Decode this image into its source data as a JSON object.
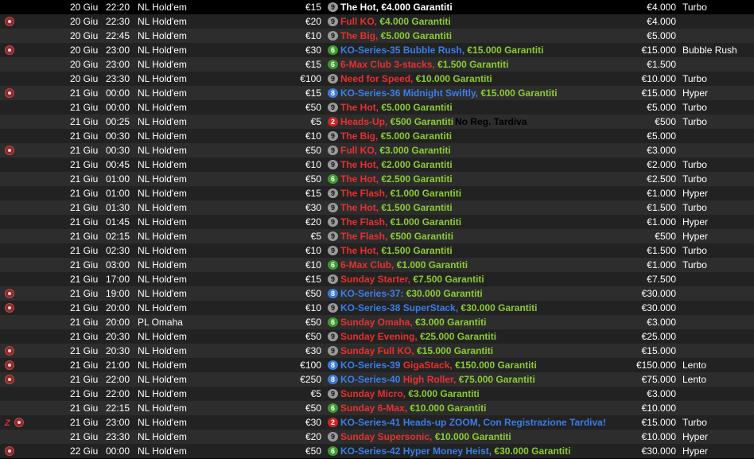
{
  "colors": {
    "red": "#e83030",
    "blue": "#3a7ee8",
    "green": "#8ccc32",
    "white": "#ffffff",
    "seat_9": "#9a9a9a",
    "seat_8": "#3d7bd8",
    "seat_6": "#3f9a2e",
    "seat_2": "#d02424"
  },
  "rows": [
    {
      "icons": [],
      "date": "20 Giu",
      "time": "22:20",
      "game": "NL Hold'em",
      "buyin": "€15",
      "seats": "9",
      "name": "The Hot,",
      "name_color": "white",
      "guarantee": " €4.000 Garantiti",
      "guarantee_color": "white",
      "note": "",
      "prize": "€4.000",
      "speed": "Turbo"
    },
    {
      "icons": [
        "ko-icon"
      ],
      "date": "20 Giu",
      "time": "22:30",
      "game": "NL Hold'em",
      "buyin": "€20",
      "seats": "9",
      "name": "Full KO,",
      "name_color": "red",
      "guarantee": " €4.000 Garantiti",
      "guarantee_color": "green",
      "note": "",
      "prize": "€4.000",
      "speed": ""
    },
    {
      "icons": [],
      "date": "20 Giu",
      "time": "22:45",
      "game": "NL Hold'em",
      "buyin": "€10",
      "seats": "9",
      "name": "The Big,",
      "name_color": "red",
      "guarantee": " €5.000 Garantiti",
      "guarantee_color": "green",
      "note": "",
      "prize": "€5.000",
      "speed": ""
    },
    {
      "icons": [
        "ko-icon"
      ],
      "date": "20 Giu",
      "time": "23:00",
      "game": "NL Hold'em",
      "buyin": "€30",
      "seats": "6",
      "name": "KO-Series-35 Bubble Rush,",
      "name_color": "blue",
      "guarantee": " €15.000 Garantiti",
      "guarantee_color": "green",
      "note": "",
      "prize": "€15.000",
      "speed": "Bubble Rush"
    },
    {
      "icons": [],
      "date": "20 Giu",
      "time": "23:00",
      "game": "NL Hold'em",
      "buyin": "€15",
      "seats": "6",
      "name": "6-Max Club 3-stacks,",
      "name_color": "red",
      "guarantee": " €1.500 Garantiti",
      "guarantee_color": "green",
      "note": "",
      "prize": "€1.500",
      "speed": ""
    },
    {
      "icons": [],
      "date": "20 Giu",
      "time": "23:30",
      "game": "NL Hold'em",
      "buyin": "€100",
      "seats": "9",
      "name": "Need for Speed,",
      "name_color": "red",
      "guarantee": " €10.000 Garantiti",
      "guarantee_color": "green",
      "note": "",
      "prize": "€10.000",
      "speed": "Turbo"
    },
    {
      "icons": [
        "ko-icon"
      ],
      "date": "21 Giu",
      "time": "00:00",
      "game": "NL Hold'em",
      "buyin": "€15",
      "seats": "8",
      "name": "KO-Series-36 Midnight Swiftly,",
      "name_color": "blue",
      "guarantee": " €15.000 Garantiti",
      "guarantee_color": "green",
      "note": "",
      "prize": "€15.000",
      "speed": "Hyper"
    },
    {
      "icons": [],
      "date": "21 Giu",
      "time": "00:00",
      "game": "NL Hold'em",
      "buyin": "€50",
      "seats": "9",
      "name": "The Hot,",
      "name_color": "red",
      "guarantee": " €5.000 Garantiti",
      "guarantee_color": "green",
      "note": "",
      "prize": "€5.000",
      "speed": "Turbo"
    },
    {
      "icons": [],
      "date": "21 Giu",
      "time": "00:25",
      "game": "NL Hold'em",
      "buyin": "€5",
      "seats": "2",
      "name": "Heads-Up,",
      "name_color": "red",
      "guarantee": " €500 Garantiti",
      "guarantee_color": "green",
      "note": "No Reg. Tardiva",
      "prize": "€500",
      "speed": "Turbo"
    },
    {
      "icons": [],
      "date": "21 Giu",
      "time": "00:30",
      "game": "NL Hold'em",
      "buyin": "€10",
      "seats": "9",
      "name": "The Big,",
      "name_color": "red",
      "guarantee": " €5.000 Garantiti",
      "guarantee_color": "green",
      "note": "",
      "prize": "€5.000",
      "speed": ""
    },
    {
      "icons": [
        "ko-icon"
      ],
      "date": "21 Giu",
      "time": "00:30",
      "game": "NL Hold'em",
      "buyin": "€50",
      "seats": "9",
      "name": "Full KO,",
      "name_color": "red",
      "guarantee": " €3.000 Garantiti",
      "guarantee_color": "green",
      "note": "",
      "prize": "€3.000",
      "speed": ""
    },
    {
      "icons": [],
      "date": "21 Giu",
      "time": "00:45",
      "game": "NL Hold'em",
      "buyin": "€10",
      "seats": "9",
      "name": "The Hot,",
      "name_color": "red",
      "guarantee": " €2.000 Garantiti",
      "guarantee_color": "green",
      "note": "",
      "prize": "€2.000",
      "speed": "Turbo"
    },
    {
      "icons": [],
      "date": "21 Giu",
      "time": "01:00",
      "game": "NL Hold'em",
      "buyin": "€50",
      "seats": "6",
      "name": "The Hot,",
      "name_color": "red",
      "guarantee": " €2.500 Garantiti",
      "guarantee_color": "green",
      "note": "",
      "prize": "€2.500",
      "speed": "Turbo"
    },
    {
      "icons": [],
      "date": "21 Giu",
      "time": "01:00",
      "game": "NL Hold'em",
      "buyin": "€15",
      "seats": "9",
      "name": "The Flash,",
      "name_color": "red",
      "guarantee": " €1.000 Garantiti",
      "guarantee_color": "green",
      "note": "",
      "prize": "€1.000",
      "speed": "Hyper"
    },
    {
      "icons": [],
      "date": "21 Giu",
      "time": "01:30",
      "game": "NL Hold'em",
      "buyin": "€30",
      "seats": "9",
      "name": "The Hot,",
      "name_color": "red",
      "guarantee": " €1.500 Garantiti",
      "guarantee_color": "green",
      "note": "",
      "prize": "€1.500",
      "speed": "Turbo"
    },
    {
      "icons": [],
      "date": "21 Giu",
      "time": "01:45",
      "game": "NL Hold'em",
      "buyin": "€20",
      "seats": "9",
      "name": "The Flash,",
      "name_color": "red",
      "guarantee": " €1.000 Garantiti",
      "guarantee_color": "green",
      "note": "",
      "prize": "€1.000",
      "speed": "Hyper"
    },
    {
      "icons": [],
      "date": "21 Giu",
      "time": "02:15",
      "game": "NL Hold'em",
      "buyin": "€5",
      "seats": "9",
      "name": "The Flash,",
      "name_color": "red",
      "guarantee": " €500 Garantiti",
      "guarantee_color": "green",
      "note": "",
      "prize": "€500",
      "speed": "Hyper"
    },
    {
      "icons": [],
      "date": "21 Giu",
      "time": "02:30",
      "game": "NL Hold'em",
      "buyin": "€10",
      "seats": "9",
      "name": "The Hot,",
      "name_color": "red",
      "guarantee": " €1.500 Garantiti",
      "guarantee_color": "green",
      "note": "",
      "prize": "€1.500",
      "speed": "Turbo"
    },
    {
      "icons": [],
      "date": "21 Giu",
      "time": "03:00",
      "game": "NL Hold'em",
      "buyin": "€10",
      "seats": "6",
      "name": "6-Max Club,",
      "name_color": "red",
      "guarantee": " €1.000 Garantiti",
      "guarantee_color": "green",
      "note": "",
      "prize": "€1.000",
      "speed": "Turbo"
    },
    {
      "icons": [],
      "date": "21 Giu",
      "time": "17:00",
      "game": "NL Hold'em",
      "buyin": "€15",
      "seats": "9",
      "name": "Sunday Starter,",
      "name_color": "red",
      "guarantee": " €7.500 Garantiti",
      "guarantee_color": "green",
      "note": "",
      "prize": "€7.500",
      "speed": ""
    },
    {
      "icons": [
        "ko-icon"
      ],
      "date": "21 Giu",
      "time": "19:00",
      "game": "NL Hold'em",
      "buyin": "€50",
      "seats": "8",
      "name": "KO-Series-37:",
      "name_color": "blue",
      "guarantee": " €30.000 Garantiti",
      "guarantee_color": "green",
      "note": "",
      "prize": "€30.000",
      "speed": ""
    },
    {
      "icons": [
        "ko-icon"
      ],
      "date": "21 Giu",
      "time": "20:00",
      "game": "NL Hold'em",
      "buyin": "€10",
      "seats": "9",
      "name": "KO-Series-38 SuperStack,",
      "name_color": "blue",
      "guarantee": " €30.000 Garantiti",
      "guarantee_color": "green",
      "note": "",
      "prize": "€30.000",
      "speed": ""
    },
    {
      "icons": [],
      "date": "21 Giu",
      "time": "20:00",
      "game": "PL Omaha",
      "buyin": "€50",
      "seats": "6",
      "name": "Sunday Omaha,",
      "name_color": "red",
      "guarantee": " €3.000 Garantiti",
      "guarantee_color": "green",
      "note": "",
      "prize": "€3.000",
      "speed": ""
    },
    {
      "icons": [],
      "date": "21 Giu",
      "time": "20:30",
      "game": "NL Hold'em",
      "buyin": "€50",
      "seats": "9",
      "name": "Sunday Evening,",
      "name_color": "red",
      "guarantee": " €25.000 Garantiti",
      "guarantee_color": "green",
      "note": "",
      "prize": "€25.000",
      "speed": ""
    },
    {
      "icons": [
        "ko-icon"
      ],
      "date": "21 Giu",
      "time": "20:30",
      "game": "NL Hold'em",
      "buyin": "€30",
      "seats": "9",
      "name": "Sunday Full KO,",
      "name_color": "red",
      "guarantee": " €15.000 Garantiti",
      "guarantee_color": "green",
      "note": "",
      "prize": "€15.000",
      "speed": ""
    },
    {
      "icons": [
        "ko-icon"
      ],
      "date": "21 Giu",
      "time": "21:00",
      "game": "NL Hold'em",
      "buyin": "€100",
      "seats": "8",
      "name": "KO-Series-39",
      "name_color": "blue",
      "name2": " GigaStack,",
      "name2_color": "red",
      "guarantee": " €150.000 Garantiti",
      "guarantee_color": "green",
      "note": "",
      "prize": "€150.000",
      "speed": "Lento"
    },
    {
      "icons": [
        "ko-icon"
      ],
      "date": "21 Giu",
      "time": "22:00",
      "game": "NL Hold'em",
      "buyin": "€250",
      "seats": "8",
      "name": "KO-Series-40",
      "name_color": "blue",
      "name2": " High Roller,",
      "name2_color": "red",
      "guarantee": " €75.000 Garantiti",
      "guarantee_color": "green",
      "note": "",
      "prize": "€75.000",
      "speed": "Lento"
    },
    {
      "icons": [],
      "date": "21 Giu",
      "time": "22:00",
      "game": "NL Hold'em",
      "buyin": "€5",
      "seats": "9",
      "name": "Sunday Micro,",
      "name_color": "red",
      "guarantee": " €3.000 Garantiti",
      "guarantee_color": "green",
      "note": "",
      "prize": "€3.000",
      "speed": ""
    },
    {
      "icons": [],
      "date": "21 Giu",
      "time": "22:15",
      "game": "NL Hold'em",
      "buyin": "€50",
      "seats": "6",
      "name": "Sunday 6-Max,",
      "name_color": "red",
      "guarantee": " €10.000 Garantiti",
      "guarantee_color": "green",
      "note": "",
      "prize": "€10.000",
      "speed": ""
    },
    {
      "icons": [
        "zoom-icon",
        "ko-icon"
      ],
      "date": "21 Giu",
      "time": "23:00",
      "game": "NL Hold'em",
      "buyin": "€30",
      "seats": "2",
      "name": "KO-Series-41 Heads-up ZOOM, Con Registrazione Tardiva!",
      "name_color": "blue",
      "guarantee": "",
      "guarantee_color": "green",
      "note": "",
      "prize": "€15.000",
      "speed": "Turbo"
    },
    {
      "icons": [],
      "date": "21 Giu",
      "time": "23:30",
      "game": "NL Hold'em",
      "buyin": "€20",
      "seats": "9",
      "name": "Sunday Supersonic,",
      "name_color": "red",
      "guarantee": " €10.000 Garantiti",
      "guarantee_color": "green",
      "note": "",
      "prize": "€10.000",
      "speed": "Hyper"
    },
    {
      "icons": [
        "ko-icon"
      ],
      "date": "22 Giu",
      "time": "00:00",
      "game": "NL Hold'em",
      "buyin": "€50",
      "seats": "6",
      "name": "KO-Series-42 Hyper Money Heist,",
      "name_color": "blue",
      "guarantee": " €30.000 Garantiti",
      "guarantee_color": "green",
      "note": "",
      "prize": "€30.000",
      "speed": "Hyper"
    }
  ]
}
